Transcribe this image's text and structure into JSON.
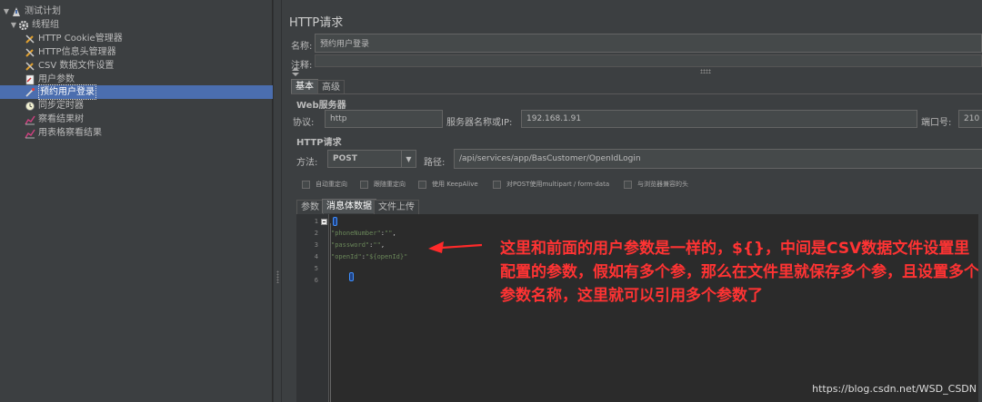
{
  "tree": {
    "items": [
      {
        "label": "测试计划",
        "icon": "test-plan-icon",
        "toggle": "▼",
        "level": 0
      },
      {
        "label": "线程组",
        "icon": "thread-group-gear-icon",
        "toggle": "▼",
        "level": 1
      },
      {
        "label": "HTTP Cookie管理器",
        "icon": "config-wrench-icon",
        "level": 2
      },
      {
        "label": "HTTP信息头管理器",
        "icon": "config-wrench-icon",
        "level": 2
      },
      {
        "label": "CSV 数据文件设置",
        "icon": "config-wrench-icon",
        "level": 2
      },
      {
        "label": "用户参数",
        "icon": "preprocessor-icon",
        "level": 2
      },
      {
        "label": "预约用户登录",
        "icon": "sampler-pipette-icon",
        "level": 2,
        "selected": true
      },
      {
        "label": "同步定时器",
        "icon": "timer-clock-icon",
        "level": 2
      },
      {
        "label": "察看结果树",
        "icon": "listener-chart-icon",
        "level": 2
      },
      {
        "label": "用表格察看结果",
        "icon": "listener-chart-icon",
        "level": 2
      }
    ]
  },
  "panel": {
    "title": "HTTP请求",
    "name_label": "名称:",
    "name_value": "预约用户登录",
    "comment_label": "注释:",
    "tabs": [
      "基本",
      "高级"
    ],
    "web_server_title": "Web服务器",
    "protocol_label": "协议:",
    "protocol_value": "http",
    "server_label": "服务器名称或IP:",
    "server_value": "192.168.1.91",
    "port_label": "端口号:",
    "port_value": "210",
    "http_request_title": "HTTP请求",
    "method_label": "方法:",
    "method_value": "POST",
    "path_label": "路径:",
    "path_value": "/api/services/app/BasCustomer/OpenIdLogin",
    "checkboxes": [
      "自动重定向",
      "跟随重定向",
      "使用 KeepAlive",
      "对POST使用multipart / form-data",
      "与浏览器兼容的头"
    ],
    "body_tabs": [
      "参数",
      "消息体数据",
      "文件上传"
    ]
  },
  "editor": {
    "line_numbers": [
      "1",
      "2",
      "3",
      "4",
      "5",
      "6"
    ],
    "lines": [
      {
        "key": "\"phoneNumber\"",
        "sep": ":",
        "val": "\"\"",
        "end": ","
      },
      {
        "key": "\"password\"",
        "sep": ":",
        "val": "\"\"",
        "end": ","
      },
      {
        "key": "\"openId\"",
        "sep": ":",
        "val": "\"${openId}\"",
        "end": ""
      }
    ]
  },
  "annotation": {
    "text": "这里和前面的用户参数是一样的，${}，中间是CSV数据文件设置里配置的参数，假如有多个参，那么在文件里就保存多个参，且设置多个参数名称，这里就可以引用多个参数了",
    "color": "#ff3333"
  },
  "watermark": "https://blog.csdn.net/WSD_CSDN",
  "colors": {
    "selection": "#4b6eaf",
    "background": "#3c3f41",
    "editor_bg": "#2b2b2b"
  }
}
